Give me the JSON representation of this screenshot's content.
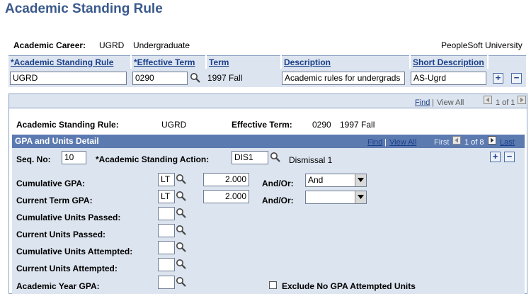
{
  "page": {
    "title": "Academic Standing Rule"
  },
  "header": {
    "career_label": "Academic Career:",
    "career_code": "UGRD",
    "career_desc": "Undergraduate",
    "institution": "PeopleSoft University"
  },
  "top_grid": {
    "columns": [
      "*Academic Standing Rule",
      "*Effective Term",
      "Term",
      "Description",
      "Short Description"
    ],
    "row": {
      "rule": "UGRD",
      "effective_term": "0290",
      "term": "1997 Fall",
      "description": "Academic rules for undergrads",
      "short_description": "AS-Ugrd"
    },
    "add_symbol": "+",
    "remove_symbol": "−"
  },
  "outer_nav": {
    "find": "Find",
    "separator": "|",
    "view_all": "View All",
    "count": "1 of 1"
  },
  "summary": {
    "rule_label": "Academic Standing Rule:",
    "rule_value": "UGRD",
    "term_label": "Effective Term:",
    "term_code": "0290",
    "term_desc": "1997 Fall"
  },
  "gpa_section": {
    "title": "GPA and Units Detail",
    "find": "Find",
    "separator": "|",
    "view_all": "View All",
    "first": "First",
    "count": "1 of 8",
    "last": "Last"
  },
  "detail": {
    "seq_label": "Seq. No:",
    "seq_value": "10",
    "action_label": "*Academic Standing Action:",
    "action_value": "DIS1",
    "action_desc": "Dismissal 1",
    "cum_gpa_label": "Cumulative GPA:",
    "cum_gpa_op": "LT",
    "cum_gpa_value": "2.000",
    "cur_gpa_label": "Current Term GPA:",
    "cur_gpa_op": "LT",
    "cur_gpa_value": "2.000",
    "andor_label": "And/Or:",
    "andor1_value": "And",
    "andor2_value": "",
    "cum_units_passed_label": "Cumulative Units Passed:",
    "cur_units_passed_label": "Current Units Passed:",
    "cum_units_attempted_label": "Cumulative Units Attempted:",
    "cur_units_attempted_label": "Current Units Attempted:",
    "acad_year_gpa_label": "Academic Year GPA:",
    "exclude_label": "Exclude No GPA Attempted Units"
  },
  "colors": {
    "title": "#3a5a8c",
    "grid_header_bg": "#dce4ef",
    "section_header_bg": "#5b7ab0",
    "link": "#1a3f8a"
  }
}
